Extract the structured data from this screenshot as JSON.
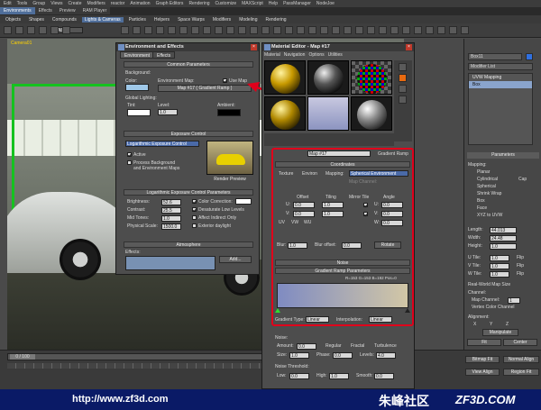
{
  "menubar": [
    "Edit",
    "Tools",
    "Group",
    "Views",
    "Create",
    "Modifiers",
    "reactor",
    "Animation",
    "Graph Editors",
    "Rendering",
    "Customize",
    "MAXScript",
    "Help",
    "PassManager",
    "NodeJoe"
  ],
  "tabs": [
    {
      "label": "Environments",
      "on": true
    },
    {
      "label": "Effects",
      "on": false
    },
    {
      "label": "Preview",
      "on": false
    },
    {
      "label": "RAM Player",
      "on": false
    }
  ],
  "subtabs": [
    {
      "label": "Objects"
    },
    {
      "label": "Shapes"
    },
    {
      "label": "Compounds"
    },
    {
      "label": "Lights & Cameras",
      "on": true
    },
    {
      "label": "Particles"
    },
    {
      "label": "Helpers"
    },
    {
      "label": "Space Warps"
    },
    {
      "label": "Modifiers"
    },
    {
      "label": "Modeling"
    },
    {
      "label": "Rendering"
    }
  ],
  "toolbar": {
    "filter": "All"
  },
  "viewport": {
    "title": "Camera01"
  },
  "env": {
    "title": "Environment and Effects",
    "tabs": [
      "Environment",
      "Effects"
    ],
    "common": {
      "header": "Common Parameters",
      "background": "Background:",
      "color": "Color:",
      "env_map": "Environment Map:",
      "use_map": "Use Map",
      "map_btn": "Map #17  ( Gradient Ramp )",
      "global": "Global Lighting:",
      "tint": "Tint:",
      "level": "Level:",
      "level_val": "1.0",
      "ambient": "Ambient:"
    },
    "exposure": {
      "header": "Exposure Control",
      "type": "Logarithmic Exposure Control",
      "active": "Active",
      "process": "Process Background",
      "process2": "and Environment Maps",
      "render_preview": "Render Preview"
    },
    "log": {
      "header": "Logarithmic Exposure Control Parameters",
      "brightness": "Brightness:",
      "brightness_v": "52.6",
      "contrast": "Contrast:",
      "contrast_v": "25.5",
      "midtones": "Mid Tones:",
      "midtones_v": "1.0",
      "phys": "Physical Scale:",
      "phys_v": "1500.0",
      "color_corr": "Color Correction:",
      "desat": "Desaturate Low Levels",
      "affect": "Affect Indirect Only",
      "exterior": "Exterior daylight"
    },
    "atmos": {
      "header": "Atmosphere",
      "effects": "Effects:",
      "add": "Add..."
    }
  },
  "mat": {
    "title": "Material Editor - Map #17",
    "menu": [
      "Material",
      "Navigation",
      "Options",
      "Utilities"
    ],
    "map_name": "Map #17",
    "map_type": "Gradient Ramp",
    "coords": {
      "header": "Coordinates",
      "texture": "Texture",
      "environ": "Environ",
      "mapping": "Mapping:",
      "mapping_v": "Spherical Environment",
      "map_channel": "Map Channel:",
      "offset": "Offset",
      "tiling": "Tiling",
      "mirror_tile": "Mirror Tile",
      "angle": "Angle",
      "u": "U:",
      "v": "V:",
      "w": "W:",
      "u_off": "0.0",
      "v_off": "0.0",
      "u_til": "1.0",
      "v_til": "1.0",
      "u_ang": "0.0",
      "v_ang": "0.0",
      "w_ang": "0.0",
      "uv": "UV",
      "vw": "VW",
      "wu": "WU",
      "blur": "Blur:",
      "blur_v": "1.0",
      "blur_off": "Blur offset:",
      "blur_off_v": "0.0",
      "rotate": "Rotate"
    },
    "noise_head": "Noise",
    "grad": {
      "header": "Gradient Ramp Parameters",
      "pos_readout": "R=153 G=153 B=192 Pos=0",
      "grad_type": "Gradient Type:",
      "grad_type_v": "Linear",
      "interp": "Interpolation:",
      "interp_v": "Linear"
    },
    "noise": {
      "label": "Noise:",
      "amount": "Amount:",
      "amount_v": "0.0",
      "regular": "Regular",
      "fractal": "Fractal",
      "turb": "Turbulence",
      "size": "Size:",
      "size_v": "1.0",
      "phase": "Phase:",
      "phase_v": "0.0",
      "levels": "Levels:",
      "levels_v": "4.0",
      "thresh": "Noise Threshold:",
      "low": "Low:",
      "low_v": "0.0",
      "high": "High:",
      "high_v": "1.0",
      "smooth": "Smooth:",
      "smooth_v": "0.0"
    }
  },
  "cmd": {
    "box": "Box11",
    "modlist": "Modifier List",
    "stack": [
      "UVW Mapping",
      "Box"
    ],
    "params": "Parameters",
    "mapping": "Mapping:",
    "opts": [
      "Planar",
      "Cylindrical",
      "Spherical",
      "Shrink Wrap",
      "Box",
      "Face",
      "XYZ to UVW"
    ],
    "cap": "Cap",
    "length": "Length:",
    "length_v": "44.013",
    "width": "Width:",
    "width_v": "24.48",
    "height": "Height:",
    "height_v": "1.0",
    "utile": "U Tile:",
    "vtile": "V Tile:",
    "wtile": "W Tile:",
    "tile_v": "1.0",
    "flip": "Flip",
    "realworld": "Real-World Map Size",
    "channel": "Channel:",
    "map_channel": "Map Channel:",
    "map_channel_v": "1",
    "vertex": "Vertex Color Channel",
    "alignment": "Alignment:",
    "x": "X",
    "y": "Y",
    "z": "Z",
    "manip": "Manipulate",
    "fit": "Fit",
    "center": "Center",
    "bitmap_fit": "Bitmap Fit",
    "normal_align": "Normal Align",
    "view_align": "View Align",
    "region_fit": "Region Fit"
  },
  "timeline": {
    "frame": "0 / 100"
  },
  "footer": {
    "url": "http://www.zf3d.com",
    "brand": "朱峰社区",
    "brand2": "ZF3D.COM"
  },
  "colors": {
    "accent": "#4f6e9a",
    "highlight": "#e0001b",
    "footer_bg": "#0a1a66"
  }
}
